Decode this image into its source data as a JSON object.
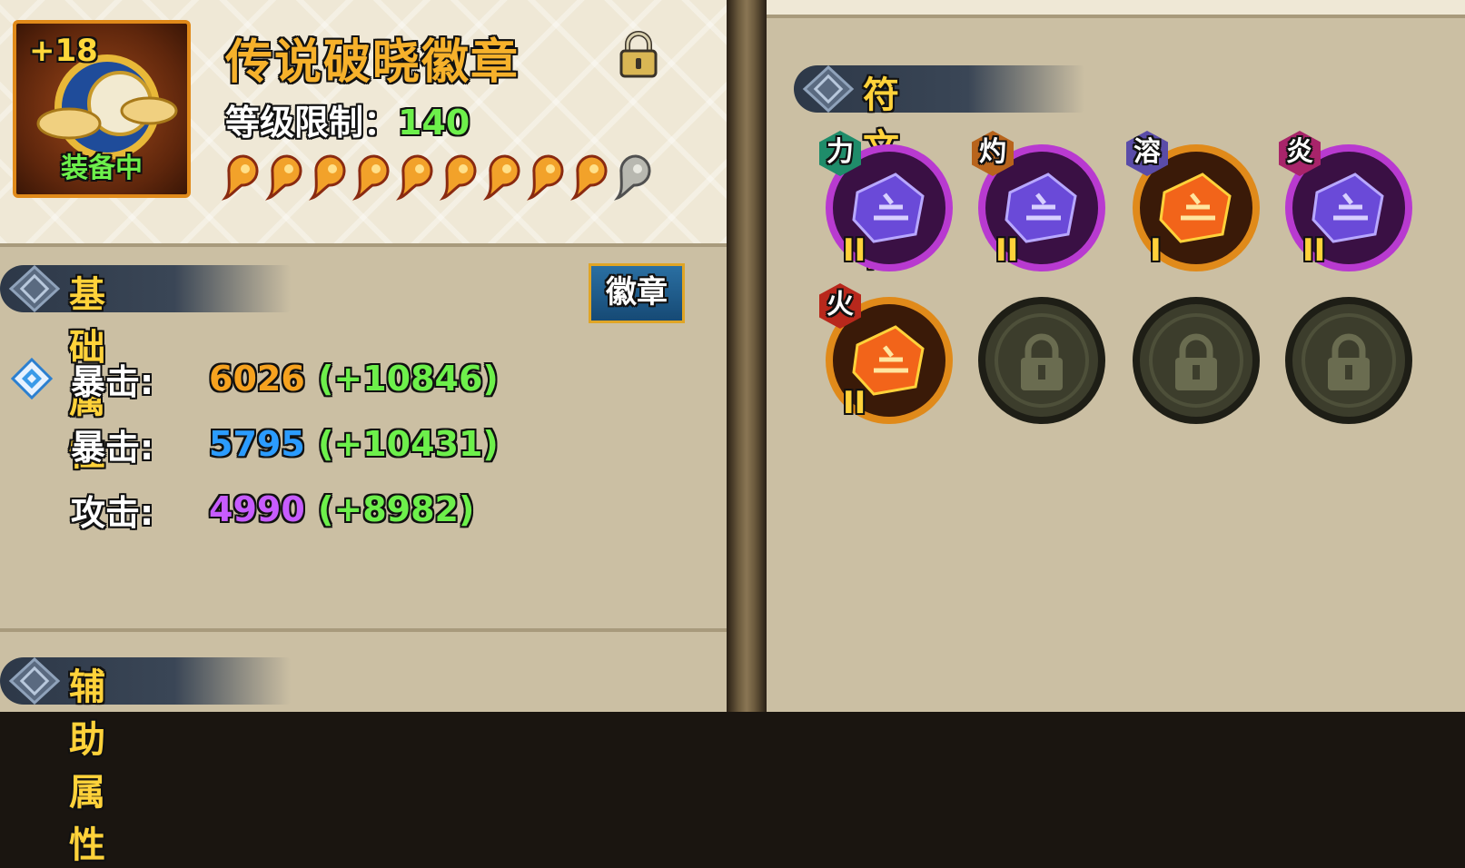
{
  "item": {
    "name": "传说破晓徽章",
    "enhance_level": "+18",
    "equipped_label": "装备中",
    "level_limit_label": "等级限制：",
    "level_limit_value": "140",
    "stars_filled": 9,
    "stars_total": 10,
    "locked": true
  },
  "basic_section": {
    "title": "基础属性",
    "badge_button_label": "徽章",
    "stats": [
      {
        "label": "暴击:",
        "value": "6026",
        "bonus": "(+10846)",
        "color": "#f6a21f"
      },
      {
        "label": "暴击:",
        "value": "5795",
        "bonus": "(+10431)",
        "color": "#2b9cff"
      },
      {
        "label": "攻击:",
        "value": "4990",
        "bonus": "(+8982)",
        "color": "#c75cff"
      }
    ]
  },
  "aux_section": {
    "title": "辅助属性"
  },
  "rune_section": {
    "title": "符文属性",
    "runes": [
      {
        "tag": "力",
        "tag_color": "#1f8c6a",
        "gem": "purple",
        "level": "II",
        "locked": false
      },
      {
        "tag": "灼",
        "tag_color": "#b8641c",
        "gem": "purple",
        "level": "II",
        "locked": false
      },
      {
        "tag": "溶",
        "tag_color": "#5a4ca8",
        "gem": "orange",
        "level": "I",
        "locked": false
      },
      {
        "tag": "炎",
        "tag_color": "#a8246a",
        "gem": "purple",
        "level": "II",
        "locked": false
      },
      {
        "tag": "火",
        "tag_color": "#b8281c",
        "gem": "orange",
        "level": "II",
        "locked": false
      },
      {
        "tag": "",
        "tag_color": "",
        "gem": "none",
        "level": "",
        "locked": true
      },
      {
        "tag": "",
        "tag_color": "",
        "gem": "none",
        "level": "",
        "locked": true
      },
      {
        "tag": "",
        "tag_color": "",
        "gem": "none",
        "level": "",
        "locked": true
      }
    ]
  },
  "colors": {
    "accent_gold": "#f6b12b",
    "bonus_green": "#6df04b",
    "panel_bg": "#cbbfa3"
  }
}
